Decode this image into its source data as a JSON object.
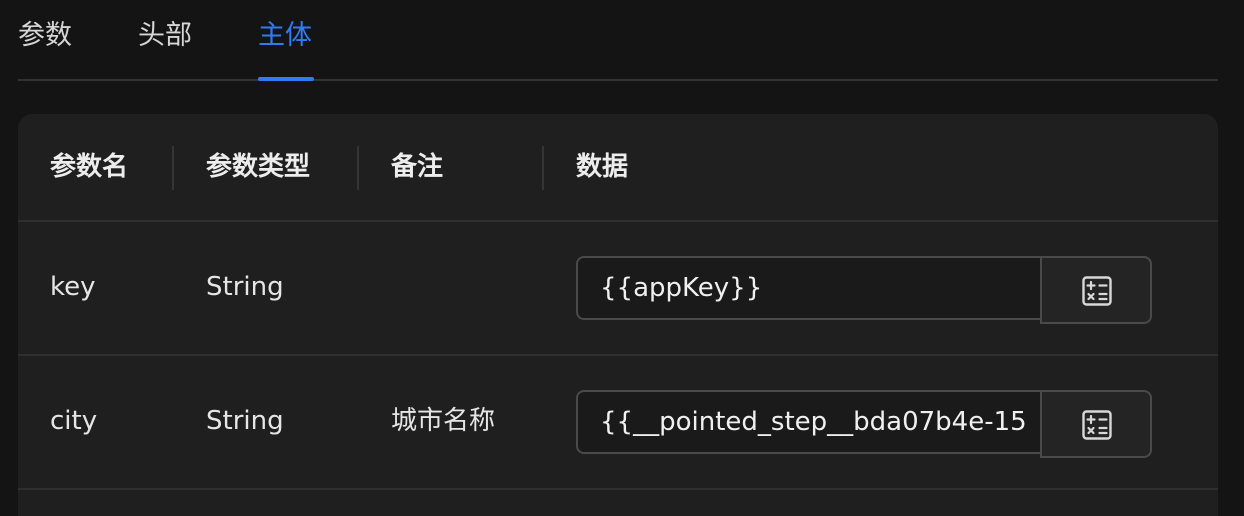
{
  "tabs": [
    {
      "label": "参数",
      "active": false
    },
    {
      "label": "头部",
      "active": false
    },
    {
      "label": "主体",
      "active": true
    }
  ],
  "table": {
    "headers": [
      "参数名",
      "参数类型",
      "备注",
      "数据"
    ],
    "rows": [
      {
        "name": "key",
        "type": "String",
        "note": "",
        "value": "{{appKey}}"
      },
      {
        "name": "city",
        "type": "String",
        "note": "城市名称",
        "value": "{{__pointed_step__bda07b4e-15"
      }
    ]
  },
  "icons": {
    "calc_button": "calculator-icon"
  },
  "colors": {
    "accent": "#2f7bf5",
    "background": "#141414",
    "table_background": "#1f1f1f"
  }
}
